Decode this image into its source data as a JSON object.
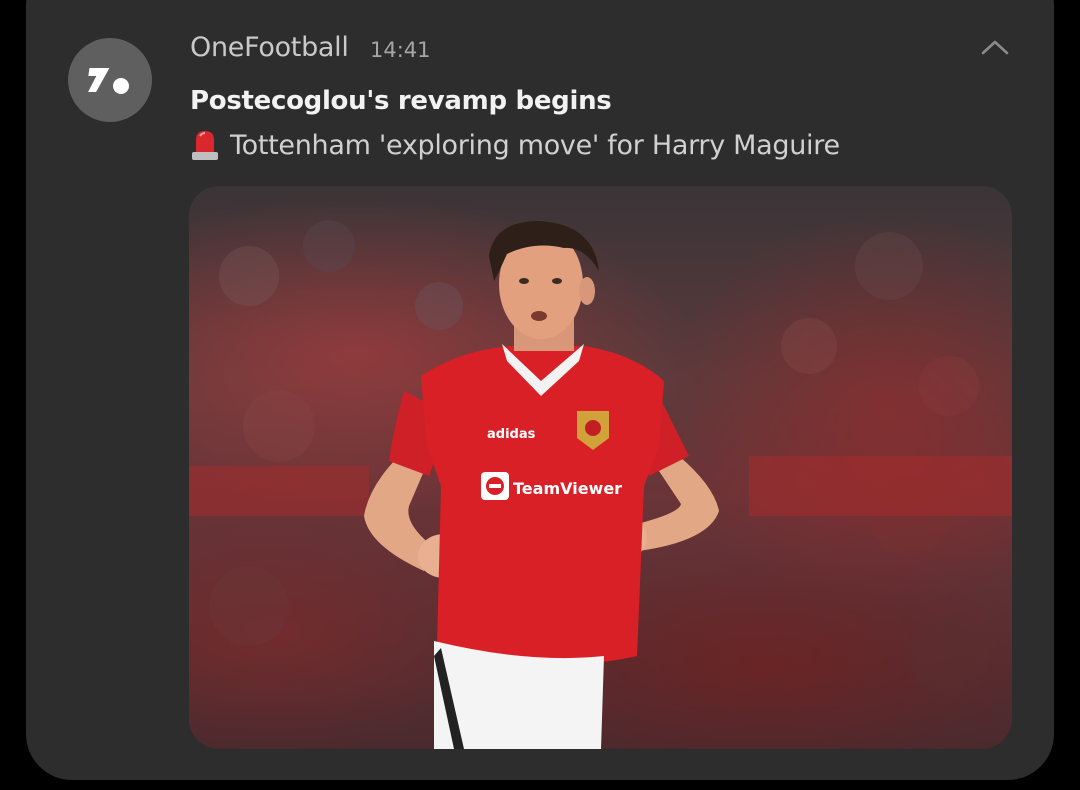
{
  "notification": {
    "app_name": "OneFootball",
    "time": "14:41",
    "title": "Postecoglou's revamp begins",
    "body": "Tottenham 'exploring move' for Harry Maguire",
    "body_icon": "siren-icon",
    "app_icon": "onefootball-logo-icon",
    "collapse_icon": "chevron-up-icon"
  },
  "image": {
    "shirt_sponsor": "TeamViewer",
    "shirt_brand": "adidas"
  },
  "colors": {
    "card_bg": "#2d2d2d",
    "app_icon_bg": "#5f5f5f",
    "jersey_red": "#d92027"
  }
}
